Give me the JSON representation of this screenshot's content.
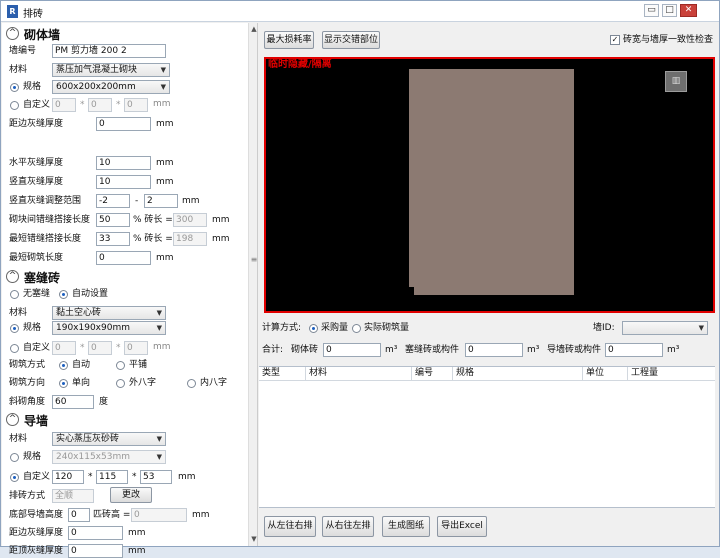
{
  "window": {
    "title": "排砖",
    "minimize": "▭",
    "maximize": "□",
    "close": "✕",
    "app_icon": "R"
  },
  "masonry": {
    "section_title": "砌体墙",
    "wall_id_label": "墙编号",
    "wall_id_value": "PM  剪力墙  200 2",
    "material_label": "材料",
    "material_value": "蒸压加气混凝土砌块",
    "spec_label": "规格",
    "spec_value": "600x200x200mm",
    "custom_label": "自定义",
    "dim1": "0",
    "dim2": "0",
    "dim3": "0",
    "unit": "mm",
    "times": "*",
    "side_gap_label": "距边灰缝厚度",
    "side_gap_value": "0",
    "side_gap_unit": "mm",
    "h_gap_label": "水平灰缝厚度",
    "h_gap_value": "10",
    "h_gap_unit": "mm",
    "v_gap_label": "竖直灰缝厚度",
    "v_gap_value": "10",
    "v_gap_unit": "mm",
    "v_adj_label": "竖直灰缝调整范围",
    "v_adj_min": "-2",
    "v_adj_dash": "-",
    "v_adj_max": "2",
    "v_adj_unit": "mm",
    "lap_label": "砌块间错缝搭接长度",
    "lap_value": "50",
    "lap_pct": "% 砖长 =",
    "lap_calc": "300",
    "lap_unit": "mm",
    "min_lap_label": "最短错缝搭接长度",
    "min_lap_value": "33",
    "min_lap_pct": "% 砖长 =",
    "min_lap_calc": "198",
    "min_lap_unit": "mm",
    "min_brick_label": "最短砌筑长度",
    "min_brick_value": "0",
    "min_brick_unit": "mm"
  },
  "filler": {
    "section_title": "塞缝砖",
    "none_label": "无塞缝",
    "auto_label": "自动设置",
    "material_label": "材料",
    "material_value": "黏土空心砖",
    "spec_label": "规格",
    "spec_value": "190x190x90mm",
    "custom_label": "自定义",
    "dim1": "0",
    "dim2": "0",
    "dim3": "0",
    "unit": "mm",
    "times": "*",
    "method_label": "砌筑方式",
    "method_auto": "自动",
    "method_flat": "平铺",
    "dir_label": "砌筑方向",
    "dir_single": "单向",
    "dir_out": "外八字",
    "dir_in": "内八字",
    "angle_label": "斜砌角度",
    "angle_value": "60",
    "angle_unit": "度"
  },
  "guide": {
    "section_title": "导墙",
    "material_label": "材料",
    "material_value": "实心蒸压灰砂砖",
    "spec_label": "规格",
    "spec_value": "240x115x53mm",
    "custom_label": "自定义",
    "dim1": "120",
    "dim2": "115",
    "dim3": "53",
    "unit": "mm",
    "times": "*",
    "layout_label": "排砖方式",
    "layout_value": "全顺",
    "change_button": "更改",
    "bottom_label": "底部导墙高度",
    "bottom_value": "0",
    "course_label": "匹砖高 =",
    "course_value": "0",
    "course_unit": "mm",
    "side_gap_label": "距边灰缝厚度",
    "side_gap_value": "0",
    "side_gap_unit": "mm",
    "top_gap_label": "距顶灰缝厚度",
    "top_gap_value": "0",
    "top_gap_unit": "mm"
  },
  "toolbar": {
    "max_loss": "最大损耗率",
    "show_joint": "显示交错部位",
    "consistency_check": "砖宽与墙厚一致性检查"
  },
  "preview": {
    "tag": "临时隐藏/隔离",
    "view_icon": "▥"
  },
  "calc": {
    "method_label": "计算方式:",
    "purchase_label": "采购量",
    "actual_label": "实际砌筑量",
    "wall_id_label": "墙ID:",
    "wall_id_value": "",
    "total_label": "合计:",
    "brick_label": "砌体砖",
    "brick_value": "0",
    "brick_unit": "m³",
    "filler_label": "塞缝砖或构件",
    "filler_value": "0",
    "filler_unit": "m³",
    "guide_label": "导墙砖或构件",
    "guide_value": "0",
    "guide_unit": "m³"
  },
  "table": {
    "columns": [
      "类型",
      "材料",
      "编号",
      "规格",
      "单位",
      "工程量"
    ]
  },
  "actions": {
    "left_to_right": "从左往右排",
    "right_to_left": "从右往左排",
    "gen_drawing": "生成图纸",
    "export_excel": "导出Excel"
  }
}
